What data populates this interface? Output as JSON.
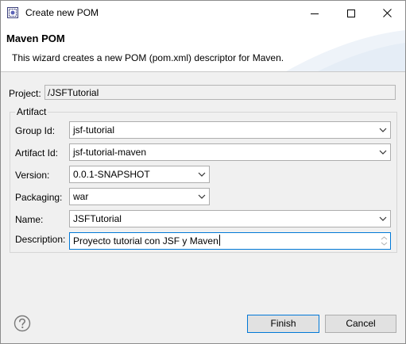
{
  "window": {
    "title": "Create new POM"
  },
  "header": {
    "title": "Maven POM",
    "description": "This wizard creates a new POM (pom.xml) descriptor for Maven."
  },
  "project": {
    "label": "Project:",
    "value": "/JSFTutorial"
  },
  "artifact": {
    "group_title": "Artifact",
    "group_id": {
      "label": "Group Id:",
      "value": "jsf-tutorial"
    },
    "artifact_id": {
      "label": "Artifact Id:",
      "value": "jsf-tutorial-maven"
    },
    "version": {
      "label": "Version:",
      "value": "0.0.1-SNAPSHOT"
    },
    "packaging": {
      "label": "Packaging:",
      "value": "war"
    },
    "name": {
      "label": "Name:",
      "value": "JSFTutorial"
    },
    "description": {
      "label": "Description:",
      "value": "Proyecto tutorial con JSF y Maven"
    }
  },
  "footer": {
    "finish_label": "Finish",
    "cancel_label": "Cancel"
  },
  "colors": {
    "accent": "#0078d7",
    "banner_deco": "#e5edf6",
    "field_border": "#adadad",
    "button_bg": "#e1e1e1"
  },
  "icons": {
    "app": "eclipse-dialog-icon",
    "minimize": "minimize-icon",
    "maximize": "maximize-icon",
    "close": "close-icon",
    "dropdown": "chevron-down-icon",
    "spinner": "spinner-arrows-icon",
    "help": "help-icon"
  }
}
